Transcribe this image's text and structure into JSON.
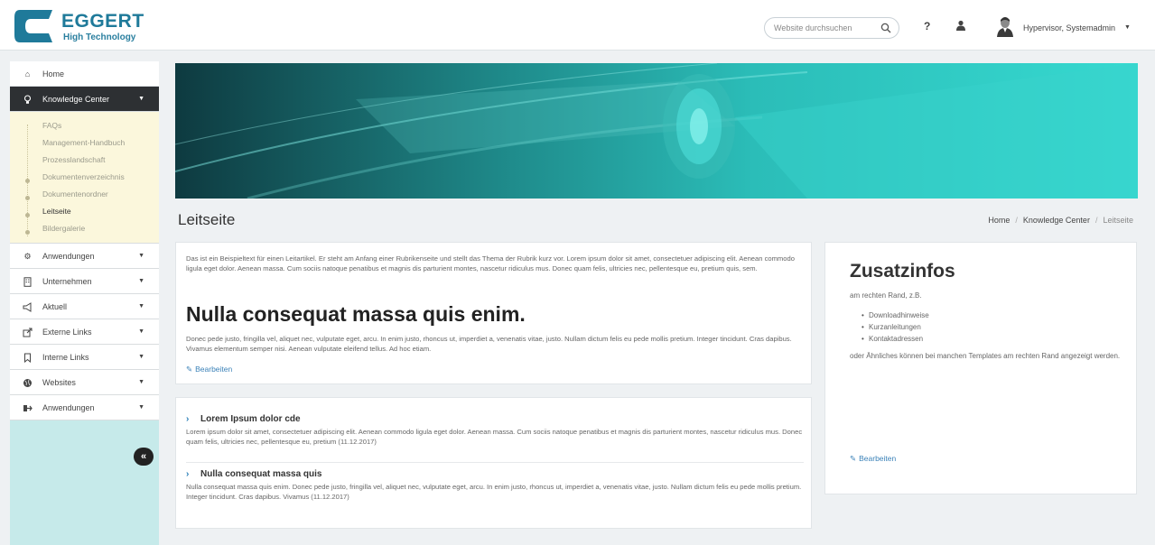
{
  "brand": {
    "name": "EGGERT",
    "tagline": "High Technology",
    "primary_color": "#1f7a9a",
    "accent_color": "#31d6cf"
  },
  "header": {
    "search_placeholder": "Website durchsuchen",
    "help_label": "?",
    "user_name": "Hypervisor, Systemadmin",
    "icons": [
      "search-icon",
      "help-icon",
      "user-icon",
      "avatar",
      "chevron-down-icon"
    ]
  },
  "sidebar": {
    "items": [
      {
        "label": "Home",
        "icon": "home-icon"
      },
      {
        "label": "Knowledge Center",
        "icon": "lightbulb-icon",
        "active": true
      },
      {
        "label": "Anwendungen",
        "icon": "gears-icon"
      },
      {
        "label": "Unternehmen",
        "icon": "building-icon"
      },
      {
        "label": "Aktuell",
        "icon": "megaphone-icon"
      },
      {
        "label": "Externe Links",
        "icon": "external-link-icon"
      },
      {
        "label": "Interne Links",
        "icon": "bookmark-icon"
      },
      {
        "label": "Websites",
        "icon": "globe-icon"
      },
      {
        "label": "Anwendungen",
        "icon": "sign-out-icon"
      }
    ],
    "submenu": [
      "FAQs",
      "Management-Handbuch",
      "Prozesslandschaft",
      "Dokumentenverzeichnis",
      "Dokumentenordner",
      "Leitseite",
      "Bildergalerie"
    ],
    "current_submenu": "Leitseite",
    "collapse_label": "«"
  },
  "page": {
    "title": "Leitseite",
    "breadcrumb": [
      "Home",
      "Knowledge Center",
      "Leitseite"
    ]
  },
  "main": {
    "lead": "Das ist ein Beispieltext für einen Leitartikel. Er steht am Anfang einer Rubrikenseite und stellt das Thema der Rubrik kurz vor. Lorem ipsum dolor sit amet, consectetuer adipiscing elit. Aenean commodo ligula eget dolor. Aenean massa. Cum sociis natoque penatibus et magnis dis parturient montes, nascetur ridiculus mus. Donec quam felis, ultricies nec, pellentesque eu, pretium quis, sem.",
    "heading": "Nulla consequat massa quis enim.",
    "body": "Donec pede justo, fringilla vel, aliquet nec, vulputate eget, arcu. In enim justo, rhoncus ut, imperdiet a, venenatis vitae, justo. Nullam dictum felis eu pede mollis pretium. Integer tincidunt. Cras dapibus. Vivamus elementum semper nisi. Aenean vulputate eleifend tellus. Ad hoc etiam.",
    "edit_label": "Bearbeiten"
  },
  "news": [
    {
      "title": "Lorem Ipsum dolor cde",
      "text": "Lorem ipsum dolor sit amet, consectetuer adipiscing elit. Aenean commodo ligula eget dolor. Aenean massa. Cum sociis natoque penatibus et magnis dis parturient montes, nascetur ridiculus mus. Donec quam felis, ultricies nec, pellentesque eu, pretium (11.12.2017)"
    },
    {
      "title": "Nulla consequat massa quis",
      "text": "Nulla consequat massa quis enim. Donec pede justo, fringilla vel, aliquet nec, vulputate eget, arcu. In enim justo, rhoncus ut, imperdiet a, venenatis vitae, justo. Nullam dictum felis eu pede mollis pretium. Integer tincidunt. Cras dapibus. Vivamus (11.12.2017)"
    }
  ],
  "aside": {
    "title": "Zusatzinfos",
    "subtitle": "am rechten Rand, z.B.",
    "list": [
      "Downloadhinweise",
      "Kurzanleitungen",
      "Kontaktadressen"
    ],
    "after": "oder Ähnliches können bei manchen Templates am rechten Rand angezeigt werden.",
    "edit_label": "Bearbeiten"
  }
}
